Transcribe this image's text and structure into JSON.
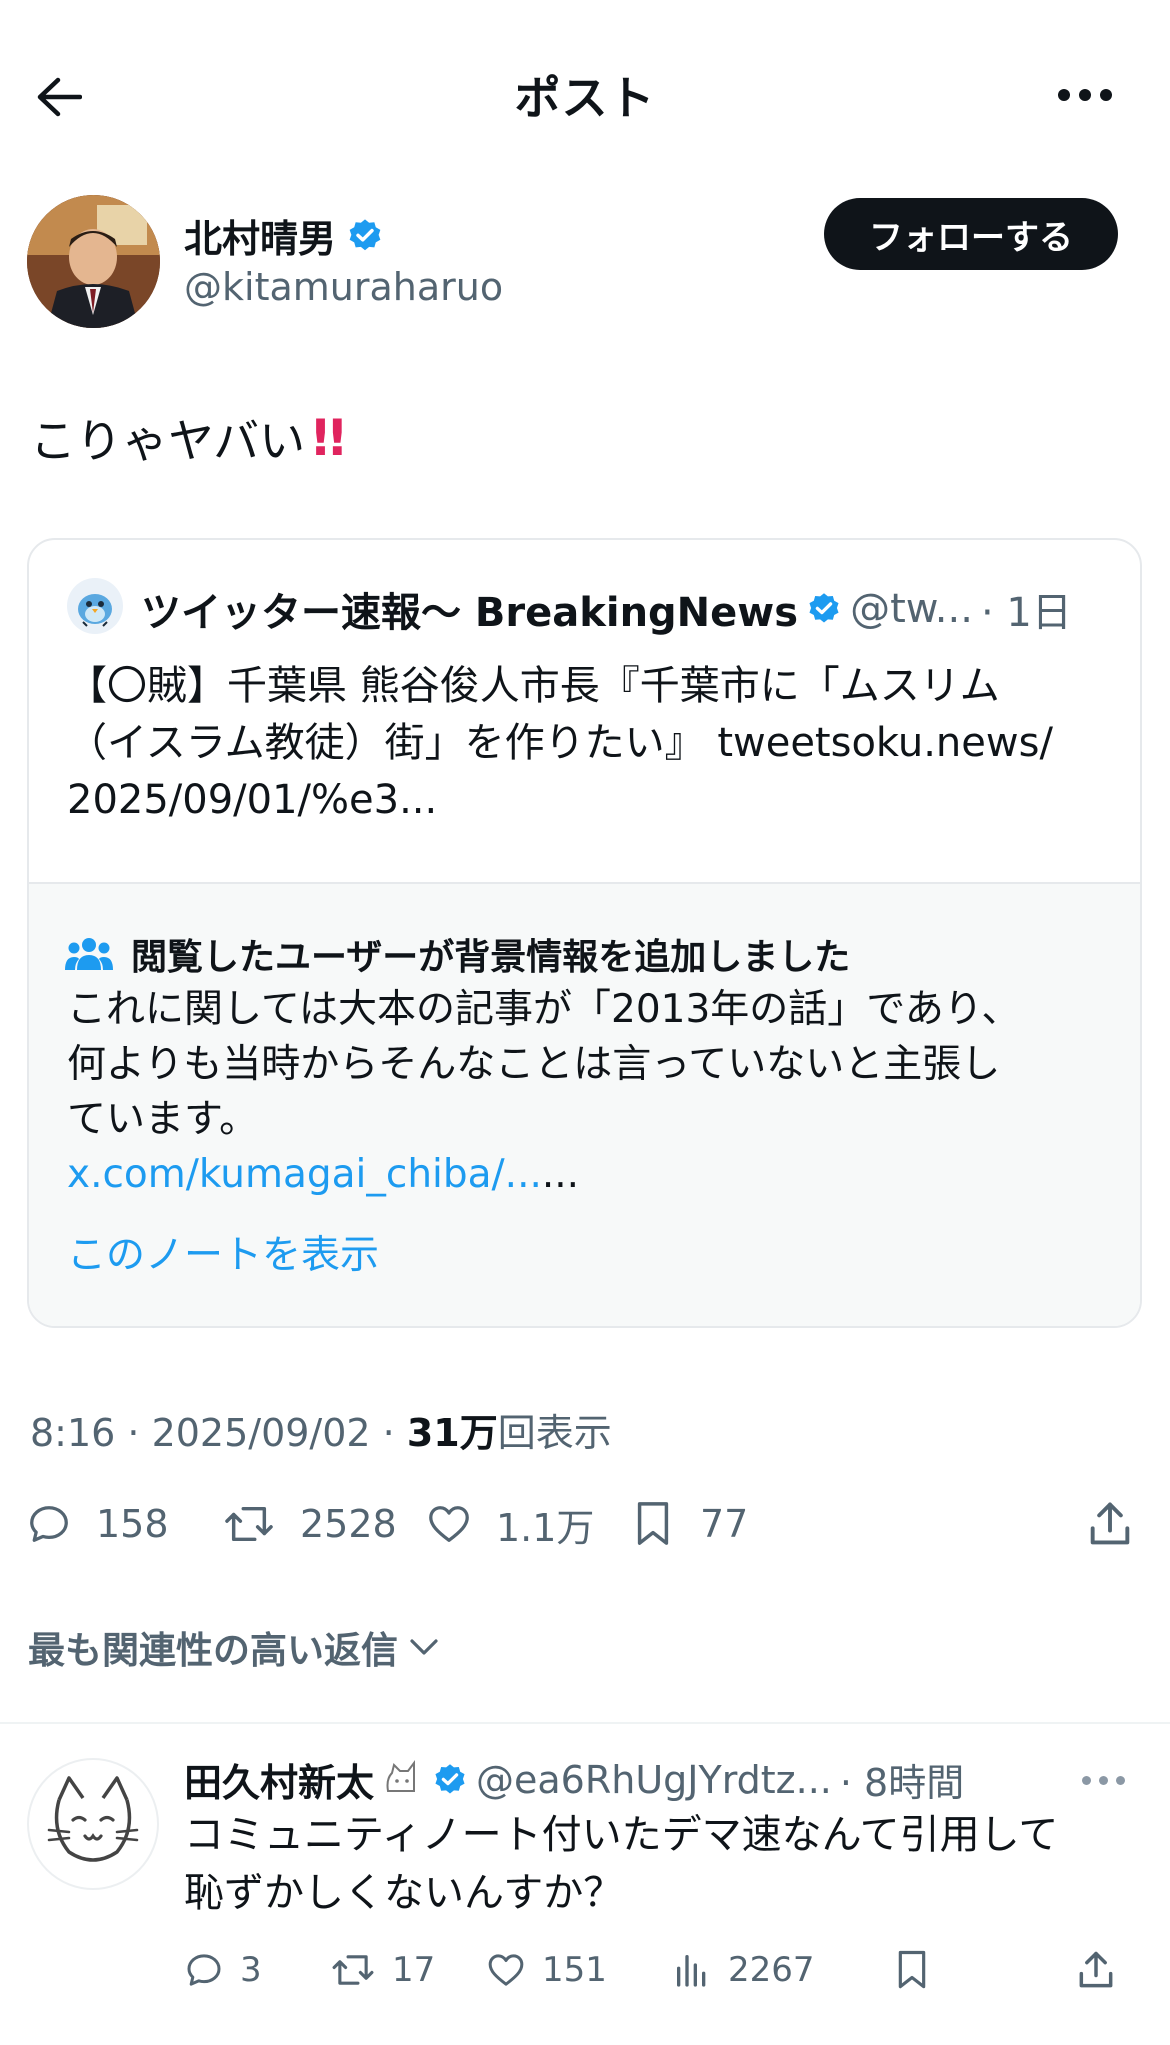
{
  "header": {
    "title": "ポスト",
    "back_icon": "arrow-left-icon",
    "more_icon": "more-icon"
  },
  "post": {
    "author_name": "北村晴男",
    "author_handle": "@kitamuraharuo",
    "follow_label": "フォローする",
    "text": "こりゃヤバい",
    "emoji": "!!",
    "quote": {
      "name": "ツイッター速報〜 BreakingNews",
      "handle": "@tw...",
      "time": "· 1日",
      "lines": [
        "【〇賊】千葉県 熊谷俊人市長『千葉市に「ムスリム",
        "（イスラム教徒）街」を作りたい』 tweetsoku.news/",
        "2025/09/01/%e3..."
      ]
    },
    "note": {
      "title": "閲覧したユーザーが背景情報を追加しました",
      "lines": [
        "これに関しては大本の記事が「2013年の話」であり、",
        "何よりも当時からそんなことは言っていないと主張し",
        "ています。"
      ],
      "link": "x.com/kumagai_chiba/...",
      "link_suffix": "...",
      "show_label": "このノートを表示"
    },
    "time": "8:16 · 2025/09/02 · ",
    "views_count": "31万",
    "views_label": "回表示",
    "stats": {
      "replies": "158",
      "reposts": "2528",
      "likes": "1.1万",
      "bookmarks": "77"
    }
  },
  "sort_label": "最も関連性の高い返信",
  "reply": {
    "name": "田久村新太",
    "handle": "@ea6RhUgJYrdtz...",
    "time": "· 8時間",
    "lines": [
      "コミュニティノート付いたデマ速なんて引用して",
      "恥ずかしくないんすか？"
    ],
    "stats": {
      "replies": "3",
      "reposts": "17",
      "likes": "151",
      "views": "2267"
    }
  },
  "colors": {
    "text": "#0f1419",
    "secondary": "#536471",
    "accent": "#1d9bf0",
    "verified": "#1d9bf0",
    "emoji_red": "#e0245e"
  }
}
